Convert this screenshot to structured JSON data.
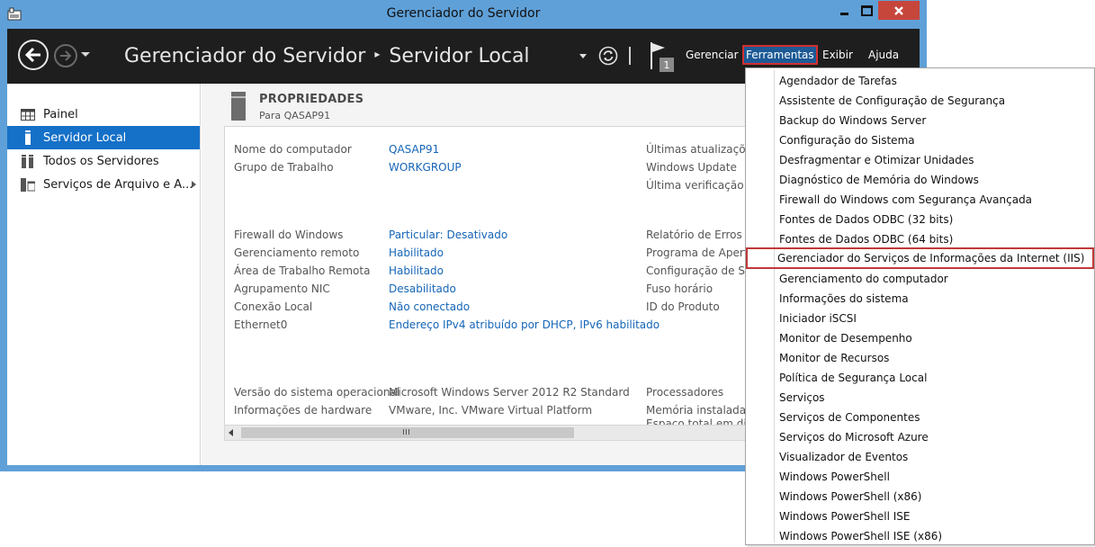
{
  "window": {
    "title": "Gerenciador do Servidor",
    "accent": "#5fa0d8",
    "close_color": "#c7463c"
  },
  "header": {
    "breadcrumb_root": "Gerenciador do Servidor",
    "breadcrumb_separator": "▸",
    "breadcrumb_current": "Servidor Local",
    "notification_count": "1",
    "menu": {
      "gerenciar": "Gerenciar",
      "ferramentas": "Ferramentas",
      "exibir": "Exibir",
      "ajuda": "Ajuda"
    }
  },
  "sidebar": {
    "items": [
      {
        "label": "Painel",
        "icon": "dashboard-grid-icon",
        "active": false
      },
      {
        "label": "Servidor Local",
        "icon": "server-icon",
        "active": true
      },
      {
        "label": "Todos os Servidores",
        "icon": "servers-icon",
        "active": false
      },
      {
        "label": "Serviços de Arquivo e A...",
        "icon": "file-services-icon",
        "active": false
      }
    ]
  },
  "properties": {
    "title": "PROPRIEDADES",
    "subtitle": "Para QASAP91",
    "left": [
      {
        "key": "Nome do computador",
        "value": "QASAP91",
        "link": true
      },
      {
        "key": "Grupo de Trabalho",
        "value": "WORKGROUP",
        "link": true
      },
      {
        "key": "Firewall do Windows",
        "value": "Particular: Desativado",
        "link": true
      },
      {
        "key": "Gerenciamento remoto",
        "value": "Habilitado",
        "link": true
      },
      {
        "key": "Área de Trabalho Remota",
        "value": "Habilitado",
        "link": true
      },
      {
        "key": "Agrupamento NIC",
        "value": "Desabilitado",
        "link": true
      },
      {
        "key": "Conexão Local",
        "value": "Não conectado",
        "link": true
      },
      {
        "key": "Ethernet0",
        "value": "Endereço IPv4 atribuído por DHCP, IPv6 habilitado",
        "link": true
      },
      {
        "key": "Versão do sistema operacional",
        "value": "Microsoft Windows Server 2012 R2 Standard",
        "link": false
      },
      {
        "key": "Informações de hardware",
        "value": "VMware, Inc. VMware Virtual Platform",
        "link": false
      }
    ],
    "right": [
      "Últimas atualizações",
      "Windows Update",
      "Última verificação de",
      "Relatório de Erros do",
      "Programa de Aperfei",
      "Configuração de Seg",
      "Fuso horário",
      "ID do Produto",
      "Processadores",
      "Memória instalada (R",
      "Espaço total em disco"
    ]
  },
  "tools_menu": {
    "items": [
      "Agendador de Tarefas",
      "Assistente de Configuração de Segurança",
      "Backup do Windows Server",
      "Configuração do Sistema",
      "Desfragmentar e Otimizar Unidades",
      "Diagnóstico de Memória do Windows",
      "Firewall do Windows com Segurança Avançada",
      "Fontes de Dados ODBC (32 bits)",
      "Fontes de Dados ODBC (64 bits)",
      "Gerenciador do Serviços de Informações da Internet (IIS)",
      "Gerenciamento do computador",
      "Informações do sistema",
      "Iniciador iSCSI",
      "Monitor de Desempenho",
      "Monitor de Recursos",
      "Política de Segurança Local",
      "Serviços",
      "Serviços de Componentes",
      "Serviços do Microsoft Azure",
      "Visualizador de Eventos",
      "Windows PowerShell",
      "Windows PowerShell (x86)",
      "Windows PowerShell ISE",
      "Windows PowerShell ISE (x86)"
    ],
    "highlighted_index": 9,
    "highlight_color": "#c0393b"
  }
}
